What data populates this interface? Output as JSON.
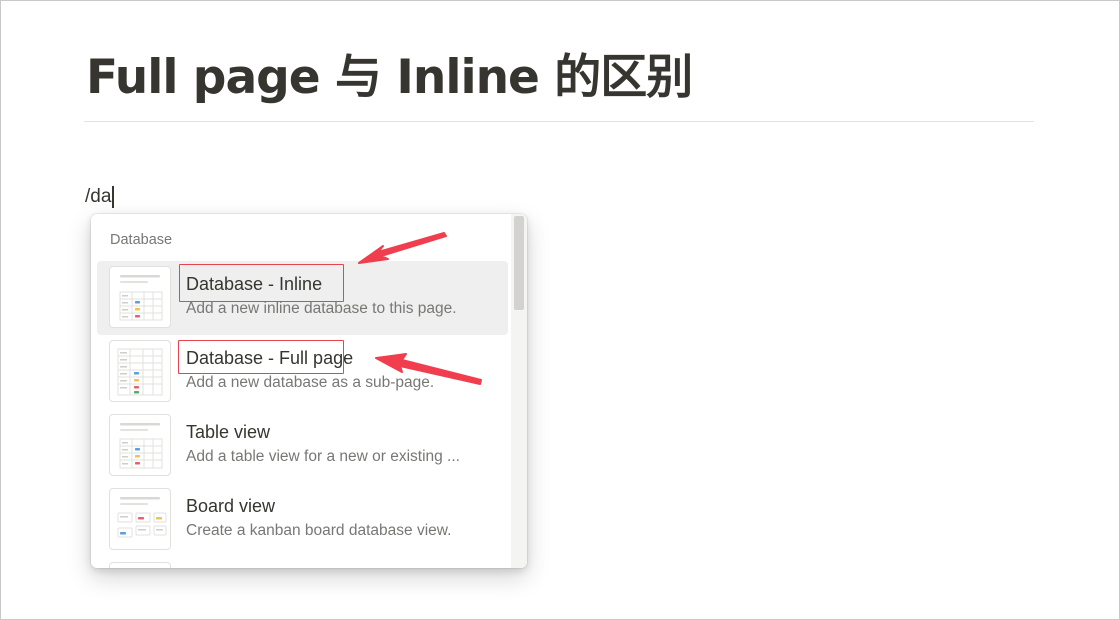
{
  "page": {
    "title": "Full page 与 Inline 的区别",
    "command_text": "/da"
  },
  "menu": {
    "section_header": "Database",
    "items": [
      {
        "title": "Database - Inline",
        "description": "Add a new inline database to this page.",
        "icon": "inline-database-thumbnail-icon",
        "selected": true,
        "highlighted": true
      },
      {
        "title": "Database - Full page",
        "description": "Add a new database as a sub-page.",
        "icon": "full-page-database-thumbnail-icon",
        "selected": false,
        "highlighted": true
      },
      {
        "title": "Table view",
        "description": "Add a table view for a new or existing ...",
        "icon": "table-view-thumbnail-icon",
        "selected": false,
        "highlighted": false
      },
      {
        "title": "Board view",
        "description": "Create a kanban board database view.",
        "icon": "board-view-thumbnail-icon",
        "selected": false,
        "highlighted": false
      }
    ]
  },
  "annotations": {
    "highlight_color": "#e8434f",
    "arrow_color": "#f03e4e"
  },
  "colors": {
    "text": "#37352f",
    "muted_text": "#787774",
    "selected_row": "#efefef",
    "tag_blue": "#5a9fe0",
    "tag_yellow": "#f2c14e",
    "tag_red": "#e8606a",
    "tag_green": "#4fae6a"
  }
}
